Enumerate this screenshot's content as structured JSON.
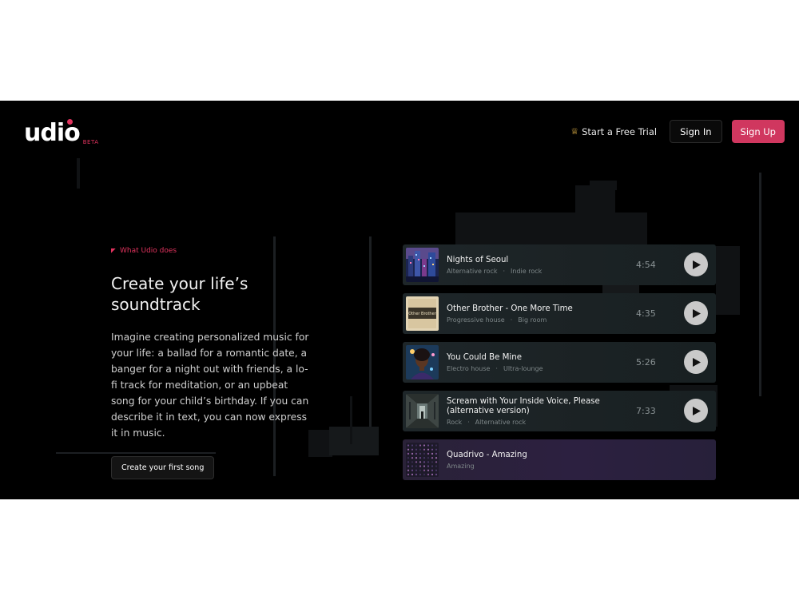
{
  "brand": {
    "name": "udio",
    "badge": "BETA",
    "accent": "#e0335e"
  },
  "nav": {
    "trial_label": "Start a Free Trial",
    "signin_label": "Sign In",
    "signup_label": "Sign Up",
    "signup_color": "#d0375f"
  },
  "hero": {
    "eyebrow": "What Udio does",
    "headline_line1": "Create your life’s",
    "headline_line2": "soundtrack",
    "body": "Imagine creating personalized music for your life: a ballad for a romantic date, a banger for a night out with friends, a lo-fi track for meditation, or an upbeat song for your child’s birthday. If you can describe it in text, you can now express it in music.",
    "cta_label": "Create your first song"
  },
  "tracks": [
    {
      "title": "Nights of Seoul",
      "genre1": "Alternative rock",
      "genre2": "Indie rock",
      "duration": "4:54",
      "icon": "city-night-art"
    },
    {
      "title": "Other Brother - One More Time",
      "genre1": "Progressive house",
      "genre2": "Big room",
      "duration": "4:35",
      "icon": "album-art-text",
      "art_text": "Other Brother"
    },
    {
      "title": "You Could Be Mine",
      "genre1": "Electro house",
      "genre2": "Ultra-lounge",
      "duration": "5:26",
      "icon": "portrait-art"
    },
    {
      "title": "Scream with Your Inside Voice, Please (alternative version)",
      "genre1": "Rock",
      "genre2": "Alternative rock",
      "duration": "7:33",
      "icon": "hallway-art"
    },
    {
      "title": "Quadrivo - Amazing",
      "genre1": "Amazing",
      "icon": "dot-grid-art"
    }
  ]
}
